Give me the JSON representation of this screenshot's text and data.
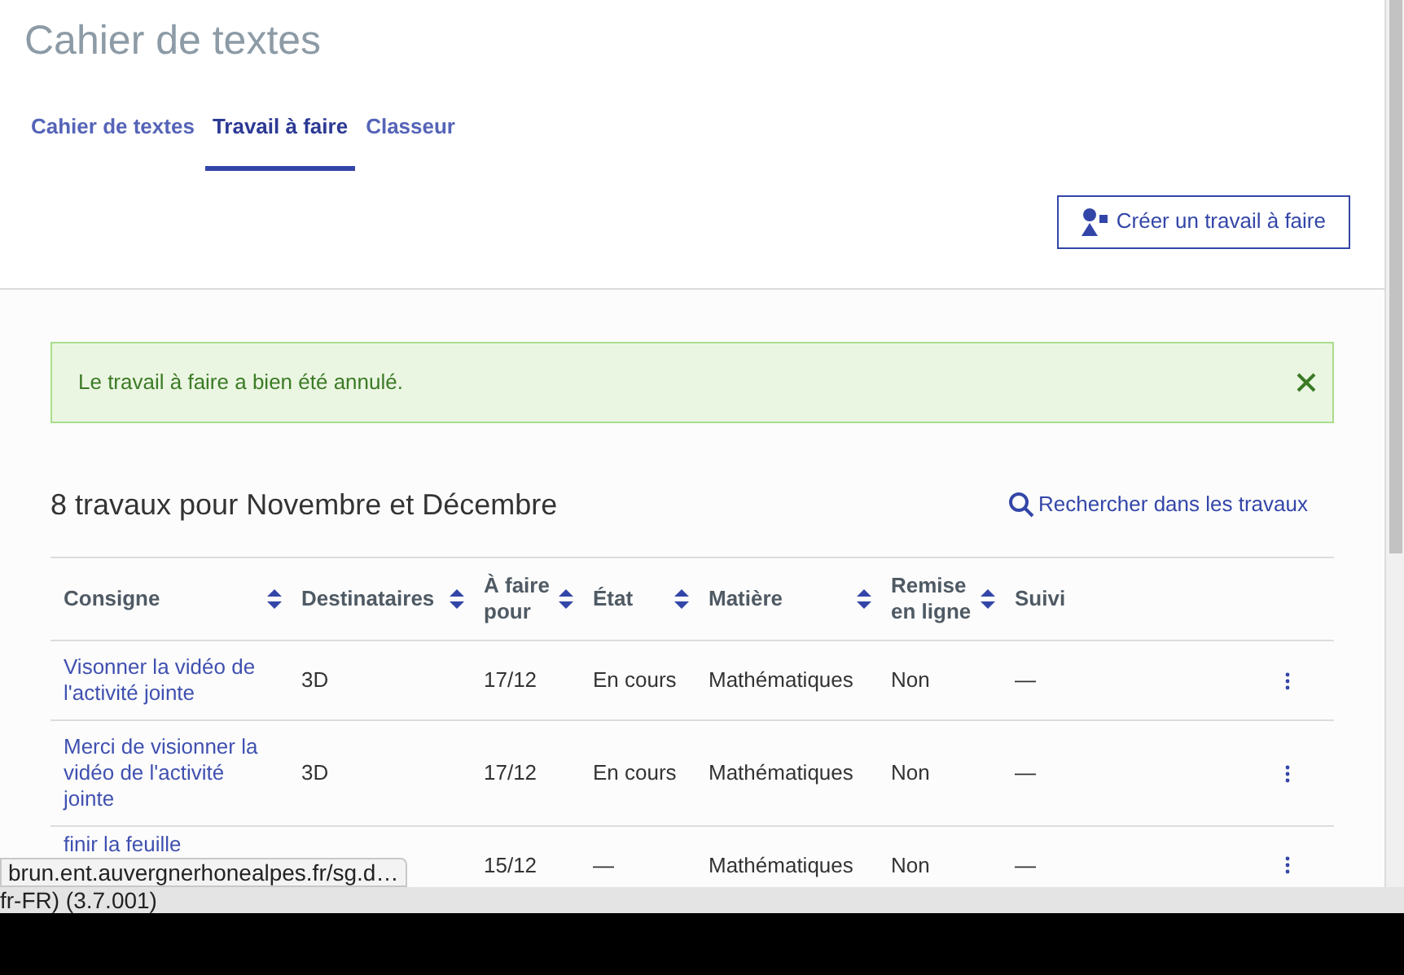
{
  "header": {
    "title": "Cahier de textes"
  },
  "tabs": [
    {
      "label": "Cahier de textes",
      "selected": false
    },
    {
      "label": "Travail à faire",
      "selected": true
    },
    {
      "label": "Classeur",
      "selected": false
    }
  ],
  "create_button": {
    "label": "Créer un travail à faire"
  },
  "alert": {
    "message": "Le travail à faire a bien été annulé."
  },
  "list": {
    "title": "8 travaux pour Novembre et Décembre",
    "search_link": "Rechercher dans les travaux"
  },
  "table": {
    "columns": [
      {
        "label": "Consigne",
        "sortable": true
      },
      {
        "label": "Destinataires",
        "sortable": true
      },
      {
        "label": "À faire pour",
        "sortable": true
      },
      {
        "label": "État",
        "sortable": true
      },
      {
        "label": "Matière",
        "sortable": true
      },
      {
        "label": "Remise en ligne",
        "sortable": true
      },
      {
        "label": "Suivi",
        "sortable": false
      }
    ],
    "rows": [
      {
        "cells": [
          "Visonner la vidéo de l'activité jointe",
          "3D",
          "17/12",
          "En cours",
          "Mathématiques",
          "Non",
          "—"
        ]
      },
      {
        "cells": [
          "Merci de visionner la vidéo de l'activité jointe",
          "3D",
          "17/12",
          "En cours",
          "Mathématiques",
          "Non",
          "—"
        ]
      },
      {
        "cells": [
          "finir la feuille",
          "",
          "15/12",
          "—",
          "Mathématiques",
          "Non",
          "—"
        ]
      }
    ]
  },
  "status_tooltip": "brun.ent.auvergnerhonealpes.fr/sg.d…",
  "window_footer": "fr-FR) (3.7.001)"
}
